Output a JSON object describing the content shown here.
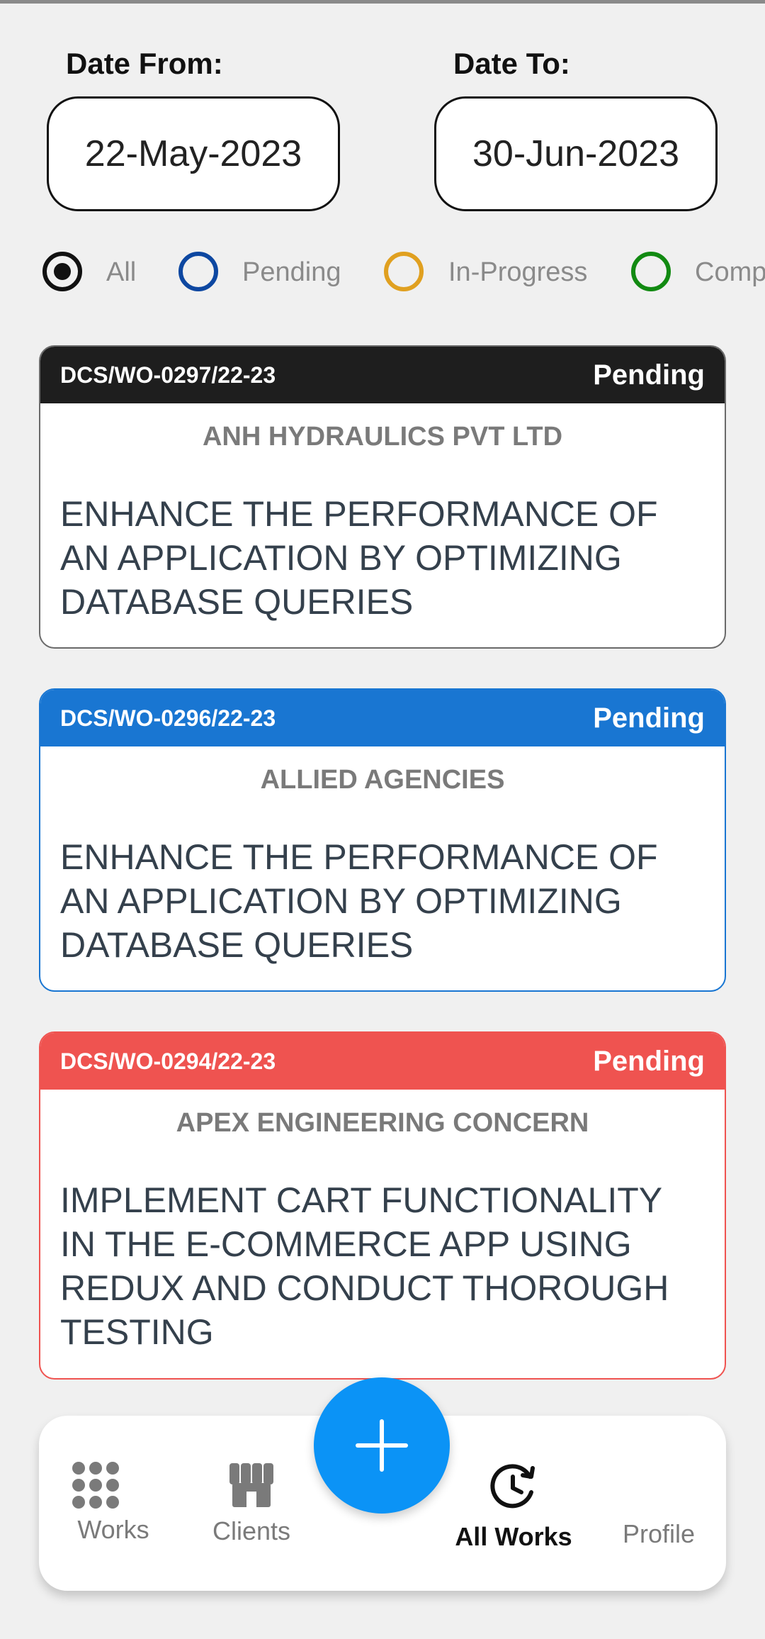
{
  "filters_section": {
    "date_from_label": "Date From:",
    "date_from_value": "22-May-2023",
    "date_to_label": "Date To:",
    "date_to_value": "30-Jun-2023",
    "status_options": [
      {
        "label": "All",
        "selected": true,
        "color": "#111111"
      },
      {
        "label": "Pending",
        "selected": false,
        "color": "#0d47a1"
      },
      {
        "label": "In-Progress",
        "selected": false,
        "color": "#e0a020"
      },
      {
        "label": "Comp",
        "selected": false,
        "color": "#128a12"
      }
    ]
  },
  "work_orders": [
    {
      "code": "DCS/WO-0297/22-23",
      "status": "Pending",
      "client": "ANH HYDRAULICS PVT LTD",
      "description": "ENHANCE THE PERFORMANCE OF AN APPLICATION BY OPTIMIZING DATABASE QUERIES",
      "header_color": "#1e1e1e"
    },
    {
      "code": "DCS/WO-0296/22-23",
      "status": "Pending",
      "client": "ALLIED AGENCIES",
      "description": "ENHANCE THE PERFORMANCE OF AN APPLICATION BY OPTIMIZING DATABASE QUERIES",
      "header_color": "#1976d2"
    },
    {
      "code": "DCS/WO-0294/22-23",
      "status": "Pending",
      "client": "APEX ENGINEERING CONCERN",
      "description": "IMPLEMENT CART FUNCTIONALITY IN THE E-COMMERCE APP USING REDUX AND CONDUCT THOROUGH TESTING",
      "header_color": "#ef5350"
    }
  ],
  "bottom_nav": {
    "items": [
      {
        "label": "Works",
        "icon": "grid-dots-icon",
        "active": false
      },
      {
        "label": "Clients",
        "icon": "storefront-icon",
        "active": false
      },
      {
        "label": "All Works",
        "icon": "clock-history-icon",
        "active": true
      },
      {
        "label": "Profile",
        "icon": "",
        "active": false
      }
    ],
    "fab_icon": "plus-icon",
    "fab_color": "#0b93f6"
  }
}
